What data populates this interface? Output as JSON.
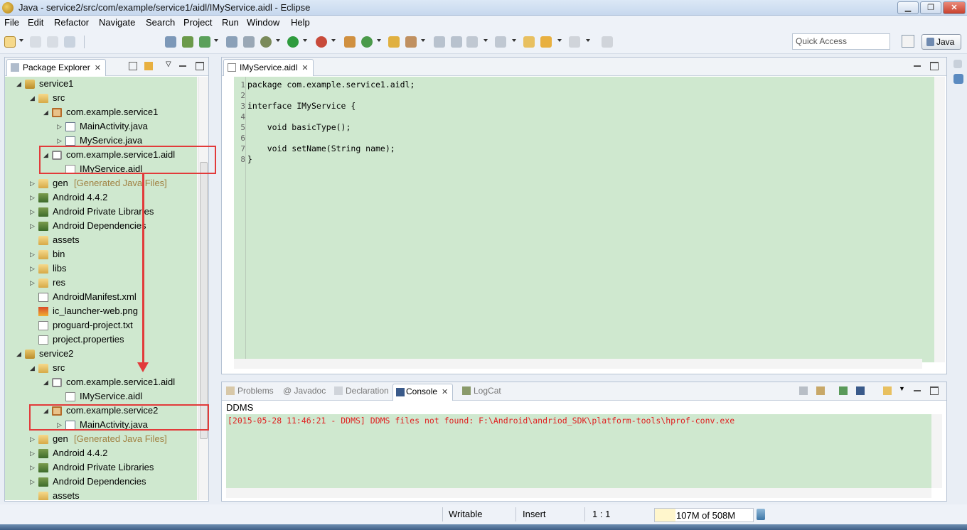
{
  "window": {
    "title": "Java - service2/src/com/example/service1/aidl/IMyService.aidl - Eclipse",
    "minimize_label": "▁",
    "maximize_label": "❐",
    "close_label": "✕"
  },
  "menu": [
    "File",
    "Edit",
    "Refactor",
    "Navigate",
    "Search",
    "Project",
    "Run",
    "Window",
    "Help"
  ],
  "toolbar": {
    "quick_access_placeholder": "Quick Access",
    "perspective_label": "Java"
  },
  "package_explorer": {
    "tab_label": "Package Explorer",
    "tree": [
      {
        "label": "service1",
        "icon": "project-icon",
        "expanded": true
      },
      {
        "label": "src",
        "icon": "folder-icon",
        "expanded": true
      },
      {
        "label": "com.example.service1",
        "icon": "package-icon",
        "expanded": true
      },
      {
        "label": "MainActivity.java",
        "icon": "java-file-icon",
        "expanded": false
      },
      {
        "label": "MyService.java",
        "icon": "java-file-icon",
        "expanded": false
      },
      {
        "label": "com.example.service1.aidl",
        "icon": "aidl-package-icon",
        "expanded": true
      },
      {
        "label": "IMyService.aidl",
        "icon": "file-icon"
      },
      {
        "label": "gen",
        "decoration": "[Generated Java Files]",
        "icon": "folder-icon",
        "expanded": false
      },
      {
        "label": "Android 4.4.2",
        "icon": "library-icon",
        "expanded": false
      },
      {
        "label": "Android Private Libraries",
        "icon": "library-icon",
        "expanded": false
      },
      {
        "label": "Android Dependencies",
        "icon": "library-icon",
        "expanded": false
      },
      {
        "label": "assets",
        "icon": "folder-icon"
      },
      {
        "label": "bin",
        "icon": "folder-icon",
        "expanded": false
      },
      {
        "label": "libs",
        "icon": "folder-icon",
        "expanded": false
      },
      {
        "label": "res",
        "icon": "folder-icon",
        "expanded": false
      },
      {
        "label": "AndroidManifest.xml",
        "icon": "xml-file-icon"
      },
      {
        "label": "ic_launcher-web.png",
        "icon": "image-file-icon"
      },
      {
        "label": "proguard-project.txt",
        "icon": "file-icon"
      },
      {
        "label": "project.properties",
        "icon": "file-icon"
      },
      {
        "label": "service2",
        "icon": "project-icon",
        "expanded": true
      },
      {
        "label": "src",
        "icon": "folder-icon",
        "expanded": true
      },
      {
        "label": "com.example.service1.aidl",
        "icon": "aidl-package-icon",
        "expanded": true
      },
      {
        "label": "IMyService.aidl",
        "icon": "file-icon"
      },
      {
        "label": "com.example.service2",
        "icon": "package-icon",
        "expanded": true
      },
      {
        "label": "MainActivity.java",
        "icon": "java-file-icon",
        "expanded": false
      },
      {
        "label": "gen",
        "decoration": "[Generated Java Files]",
        "icon": "folder-icon",
        "expanded": false
      },
      {
        "label": "Android 4.4.2",
        "icon": "library-icon",
        "expanded": false
      },
      {
        "label": "Android Private Libraries",
        "icon": "library-icon",
        "expanded": false
      },
      {
        "label": "Android Dependencies",
        "icon": "library-icon",
        "expanded": false
      },
      {
        "label": "assets",
        "icon": "folder-icon"
      }
    ]
  },
  "editor": {
    "tab_label": "IMyService.aidl",
    "line_numbers": [
      "1",
      "2",
      "3",
      "4",
      "5",
      "6",
      "7",
      "8"
    ],
    "code_lines": [
      "package com.example.service1.aidl;",
      "",
      "interface IMyService {",
      "",
      "    void basicType();",
      "",
      "    void setName(String name);",
      "}"
    ]
  },
  "bottom_panel": {
    "tabs": [
      "Problems",
      "@ Javadoc",
      "Declaration",
      "Console",
      "LogCat"
    ],
    "active_tab": "Console",
    "console_name": "DDMS",
    "console_output": "[2015-05-28 11:46:21 - DDMS] DDMS files not found: F:\\Android\\andriod_SDK\\platform-tools\\hprof-conv.exe"
  },
  "status_bar": {
    "writable": "Writable",
    "insert_mode": "Insert",
    "cursor_position": "1 : 1",
    "heap": "107M of 508M",
    "heap_used_fraction": 0.21
  },
  "colors": {
    "code_background": "#cfe8cf",
    "highlight_box": "#e23a3a",
    "console_error_text": "#e02020"
  }
}
